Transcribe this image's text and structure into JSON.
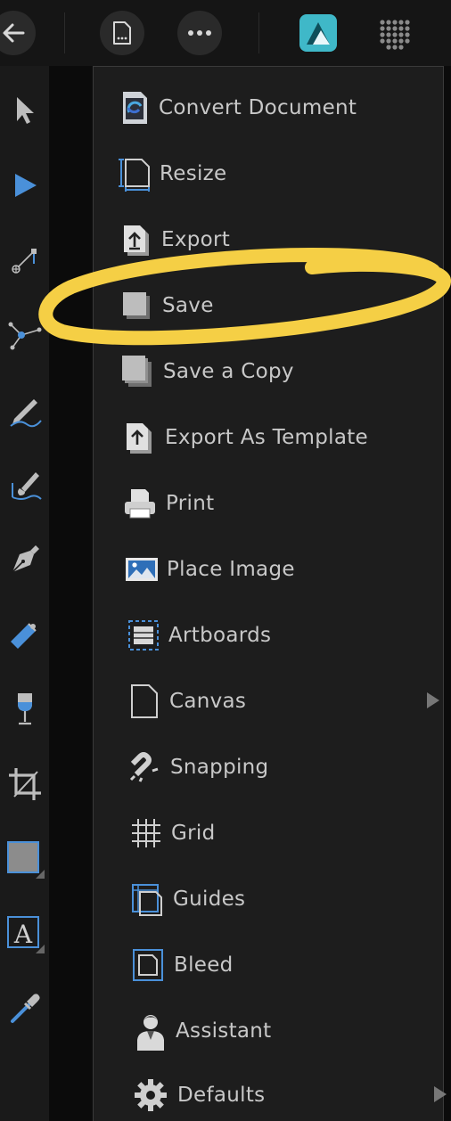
{
  "toolbar": {
    "back_icon": "arrow-left-icon",
    "document_icon": "document-icon",
    "more_icon": "more-icon",
    "app_icon": "affinity-designer-icon",
    "persona_icon": "grid-dots-icon",
    "accent": "#3fb8c8"
  },
  "menu": {
    "items": [
      {
        "label": "Convert Document",
        "icon": "convert-document-icon"
      },
      {
        "label": "Resize",
        "icon": "resize-icon"
      },
      {
        "label": "Export",
        "icon": "export-icon"
      },
      {
        "label": "Save",
        "icon": "save-icon"
      },
      {
        "label": "Save a Copy",
        "icon": "save-copy-icon"
      },
      {
        "label": "Export As Template",
        "icon": "export-template-icon"
      },
      {
        "label": "Print",
        "icon": "printer-icon"
      },
      {
        "label": "Place Image",
        "icon": "place-image-icon"
      },
      {
        "label": "Artboards",
        "icon": "artboards-icon"
      },
      {
        "label": "Canvas",
        "icon": "canvas-icon",
        "submenu": true
      },
      {
        "label": "Snapping",
        "icon": "magnet-icon"
      },
      {
        "label": "Grid",
        "icon": "grid-icon"
      },
      {
        "label": "Guides",
        "icon": "guides-icon"
      },
      {
        "label": "Bleed",
        "icon": "bleed-icon"
      },
      {
        "label": "Assistant",
        "icon": "assistant-icon"
      },
      {
        "label": "Defaults",
        "icon": "gear-icon",
        "submenu": true
      }
    ],
    "highlight_color": "#f5cf45"
  },
  "tools": [
    "move-tool-icon",
    "node-tool-icon",
    "corner-tool-icon",
    "point-transform-icon",
    "pencil-tool-icon",
    "vector-brush-icon",
    "pen-tool-icon",
    "fill-tool-icon",
    "transparency-tool-icon",
    "crop-tool-icon",
    "rectangle-tool-icon",
    "text-tool-icon",
    "color-picker-icon"
  ]
}
